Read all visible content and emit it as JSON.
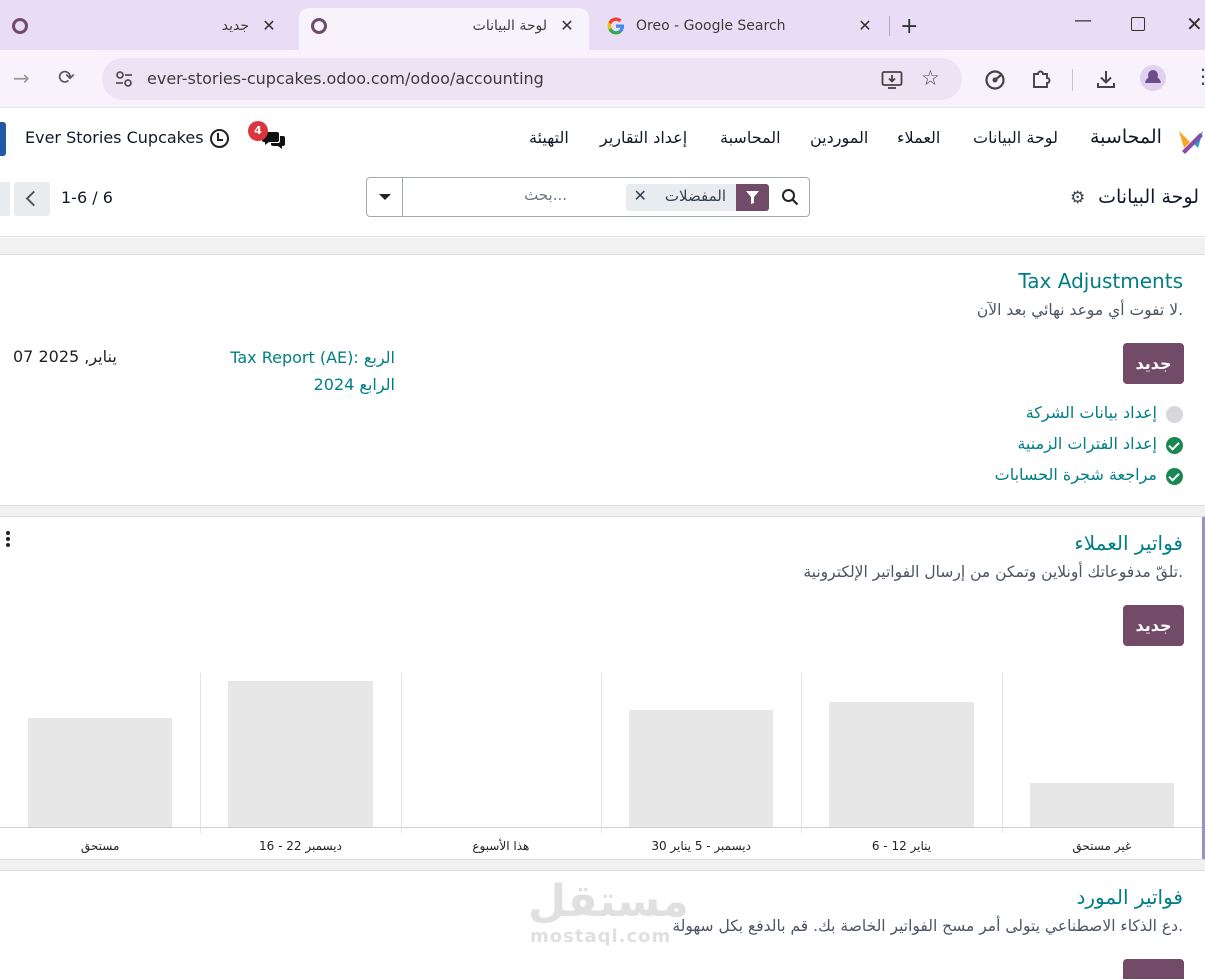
{
  "browser": {
    "tabs": [
      {
        "title": "جديد",
        "favicon": "odoo-icon"
      },
      {
        "title": "لوحة البيانات",
        "favicon": "odoo-icon",
        "active": true
      },
      {
        "title": "Oreo - Google Search",
        "favicon": "google-icon"
      }
    ],
    "url": "ever-stories-cupcakes.odoo.com/odoo/accounting"
  },
  "navbar": {
    "app_name": "المحاسبة",
    "menu": [
      "لوحة البيانات",
      "العملاء",
      "الموردين",
      "المحاسبة",
      "إعداد التقارير",
      "التهيئة"
    ],
    "company": "Ever Stories Cupcakes",
    "chat_badge": "4"
  },
  "control_panel": {
    "title": "لوحة البيانات",
    "search_placeholder": "بحث...",
    "facet_label": "المفضلات",
    "pager": "1-6 / 6"
  },
  "tax_card": {
    "title": "Tax Adjustments",
    "subtitle": "لا تفوت أي موعد نهائي بعد الآن.",
    "new_button": "جديد",
    "deadline_link_line1": "Tax Report (AE): الربع",
    "deadline_link_line2": "الرابع 2024",
    "deadline_date": "07 يناير, 2025",
    "steps": [
      {
        "label": "إعداد بيانات الشركة",
        "status": "pending"
      },
      {
        "label": "إعداد الفترات الزمنية",
        "status": "done"
      },
      {
        "label": "مراجعة شجرة الحسابات",
        "status": "done"
      }
    ]
  },
  "customer_invoices": {
    "title": "فواتير العملاء",
    "subtitle": "تلقّ مدفوعاتك أونلاين وتمكن من إرسال الفواتير الإلكترونية.",
    "new_button": "جديد",
    "chart_data": {
      "type": "bar",
      "categories": [
        "غير مستحق",
        "6 - 12 يناير",
        "30 ديسمبر - 5 يناير",
        "هذا الأسبوع",
        "16 - 22 ديسمبر",
        "مستحق"
      ],
      "values": [
        29,
        82,
        77,
        0,
        96,
        72
      ],
      "ylim": [
        0,
        100
      ],
      "grid": true
    }
  },
  "vendor_bills": {
    "title": "فواتير المورد",
    "subtitle": "دع الذكاء الاصطناعي يتولى أمر مسح الفواتير الخاصة بك. قم بالدفع بكل سهولة."
  },
  "watermark": {
    "line1": "مستقل",
    "line2": "mostaql.com"
  },
  "colors": {
    "brand": "#714B67",
    "link": "#017e84",
    "success": "#198754",
    "badge": "#d9373f"
  }
}
